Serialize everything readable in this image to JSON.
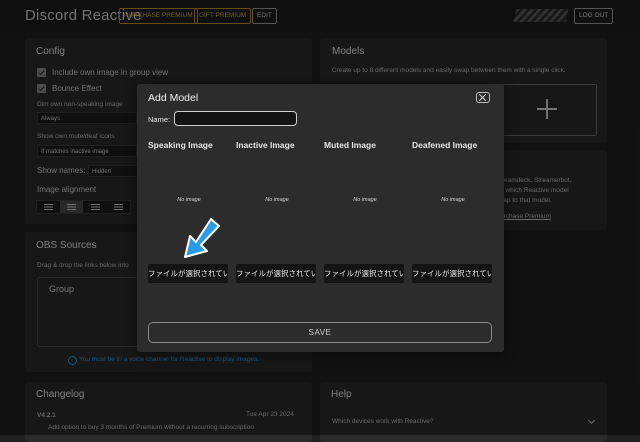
{
  "header": {
    "brand": "Discord Reactive",
    "purchase_premium": "PURCHASE PREMIUM",
    "gift_premium": "GIFT PREMIUM",
    "edit": "EDIT",
    "logout": "LOG OUT"
  },
  "config": {
    "title": "Config",
    "include_own_image": "Include own image in group view",
    "bounce_effect": "Bounce Effect",
    "dim_label": "Dim own non-speaking image",
    "dim_value": "Always",
    "show_mute_label": "Show own mute/deaf icons",
    "show_mute_value": "If matches inactive image",
    "show_names_label": "Show names:",
    "show_names_value": "Hidden",
    "image_alignment_label": "Image alignment"
  },
  "models": {
    "title": "Models",
    "description": "Create up to 8 different models and easily swap between them with a single click."
  },
  "partial_right": {
    "line1": "treamdeck, Streamerbot,",
    "line2": "g which Reactive model",
    "line3": "vap to that model.",
    "link": "urchase Premium"
  },
  "obs": {
    "title": "OBS Sources",
    "subtitle": "Drag & drop the links below into",
    "group": "Group",
    "notice": "You must be in a voice channel for Reactive to display images."
  },
  "changelog": {
    "title": "Changelog",
    "version": "V4.2.1",
    "date": "Tue Apr 23 2024",
    "entry": "Add option to buy 3 months of Premium without a recurring subscription"
  },
  "help": {
    "title": "Help",
    "question": "Which devices work with Reactive?"
  },
  "modal": {
    "title": "Add Model",
    "name_label": "Name:",
    "name_value": "",
    "columns": [
      {
        "title": "Speaking Image",
        "no_image": "No image",
        "file_button": "ファイルが選択されてい"
      },
      {
        "title": "Inactive Image",
        "no_image": "No image",
        "file_button": "ファイルが選択されてい"
      },
      {
        "title": "Muted Image",
        "no_image": "No image",
        "file_button": "ファイルが選択されてい"
      },
      {
        "title": "Deafened Image",
        "no_image": "No image",
        "file_button": "ファイルが選択されてい"
      }
    ],
    "save": "SAVE"
  },
  "colors": {
    "accent_gold": "#d7a633",
    "arrow_blue": "#2b9be8"
  },
  "icons": [
    "close-icon",
    "plus-icon",
    "info-icon",
    "chevron-down-icon",
    "checkbox-icon",
    "align-left-icon",
    "align-center-icon",
    "align-right-icon",
    "align-justify-icon",
    "pointer-arrow-icon"
  ]
}
